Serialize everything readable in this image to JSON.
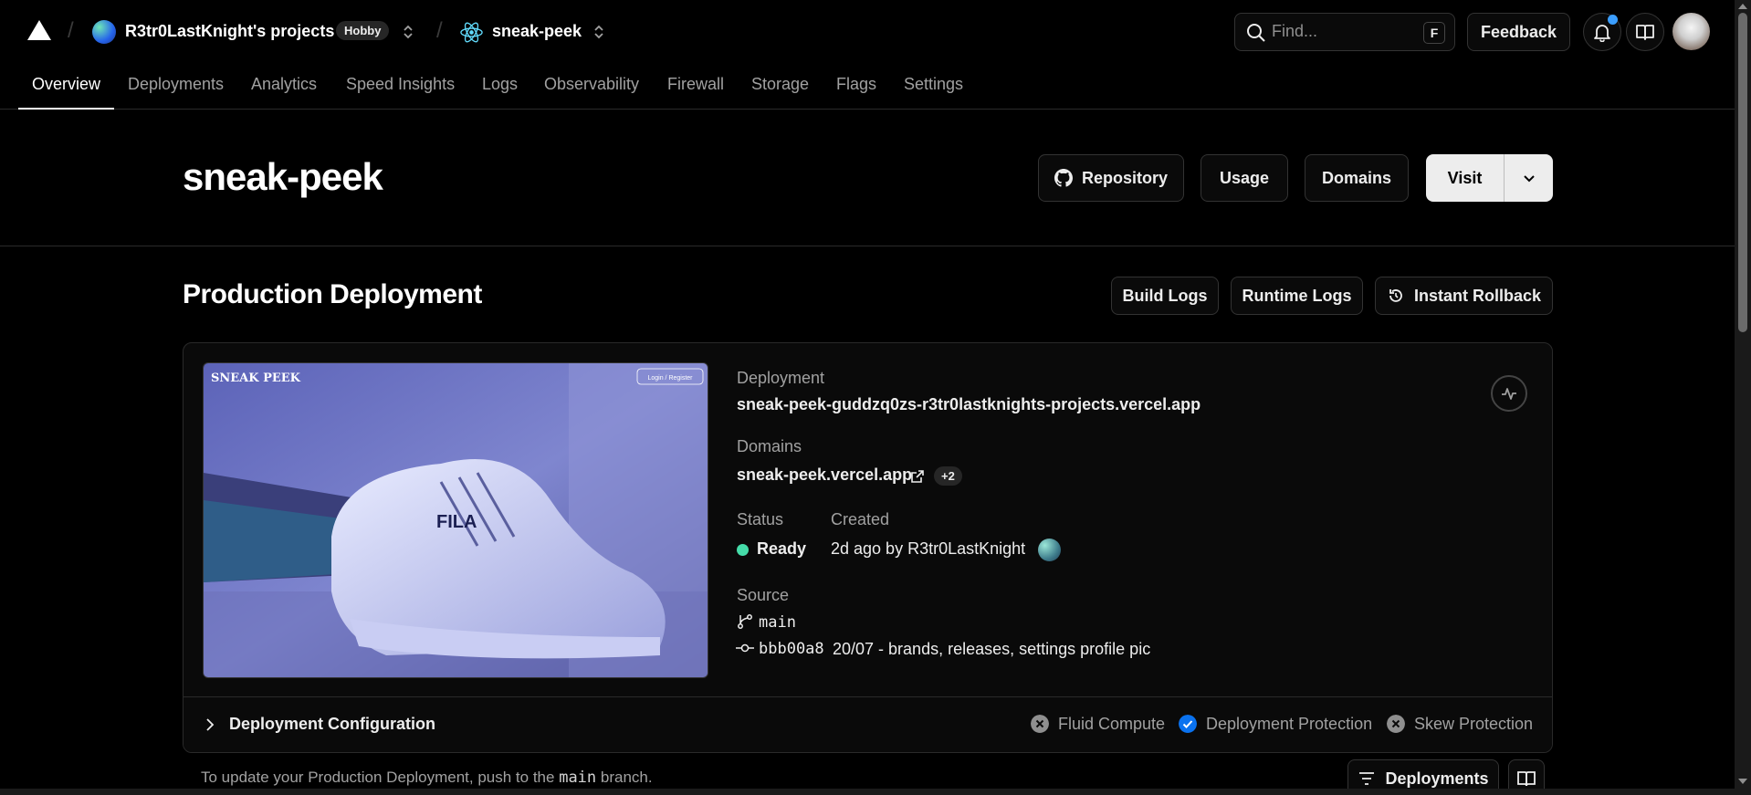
{
  "topbar": {
    "team_name": "R3tr0LastKnight's projects",
    "plan_badge": "Hobby",
    "project_name": "sneak-peek",
    "search_placeholder": "Find...",
    "search_shortcut": "F",
    "feedback_label": "Feedback"
  },
  "tabs": [
    {
      "label": "Overview",
      "active": true
    },
    {
      "label": "Deployments"
    },
    {
      "label": "Analytics"
    },
    {
      "label": "Speed Insights"
    },
    {
      "label": "Logs"
    },
    {
      "label": "Observability"
    },
    {
      "label": "Firewall"
    },
    {
      "label": "Storage"
    },
    {
      "label": "Flags"
    },
    {
      "label": "Settings"
    }
  ],
  "header": {
    "title": "sneak-peek",
    "repository_label": "Repository",
    "usage_label": "Usage",
    "domains_label": "Domains",
    "visit_label": "Visit"
  },
  "production": {
    "section_title": "Production Deployment",
    "build_logs_label": "Build Logs",
    "runtime_logs_label": "Runtime Logs",
    "rollback_label": "Instant Rollback",
    "preview": {
      "brand": "SNEAK PEEK",
      "login_label": "Login / Register",
      "shoe_brand": "FILA"
    },
    "deployment_label": "Deployment",
    "deployment_url": "sneak-peek-guddzq0zs-r3tr0lastknights-projects.vercel.app",
    "domains_label": "Domains",
    "domain": "sneak-peek.vercel.app",
    "extra_domains": "+2",
    "status_label": "Status",
    "status_value": "Ready",
    "status_color": "#45dca9",
    "created_label": "Created",
    "created_value": "2d ago by R3tr0LastKnight",
    "source_label": "Source",
    "branch": "main",
    "commit_hash": "bbb00a8",
    "commit_message": "20/07 - brands, releases, settings profile pic",
    "config_title": "Deployment Configuration",
    "features": [
      {
        "label": "Fluid Compute",
        "enabled": false
      },
      {
        "label": "Deployment Protection",
        "enabled": true
      },
      {
        "label": "Skew Protection",
        "enabled": false
      }
    ]
  },
  "footer": {
    "text_before": "To update your Production Deployment, push to the",
    "branch": "main",
    "text_after": "branch.",
    "deployments_label": "Deployments"
  },
  "colors": {
    "background": "#000000",
    "accent_blue": "#0a72ef",
    "notification": "#3b9eff"
  }
}
